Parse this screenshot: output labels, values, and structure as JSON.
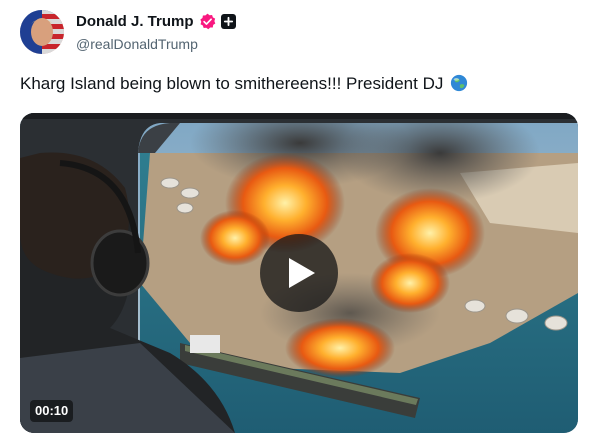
{
  "author": {
    "display_name": "Donald J. Trump",
    "handle": "@realDonaldTrump",
    "badge_color": "#f91880"
  },
  "post": {
    "text": "Kharg Island being blown to smithereens!!! President DJ"
  },
  "video": {
    "duration": "00:10"
  }
}
